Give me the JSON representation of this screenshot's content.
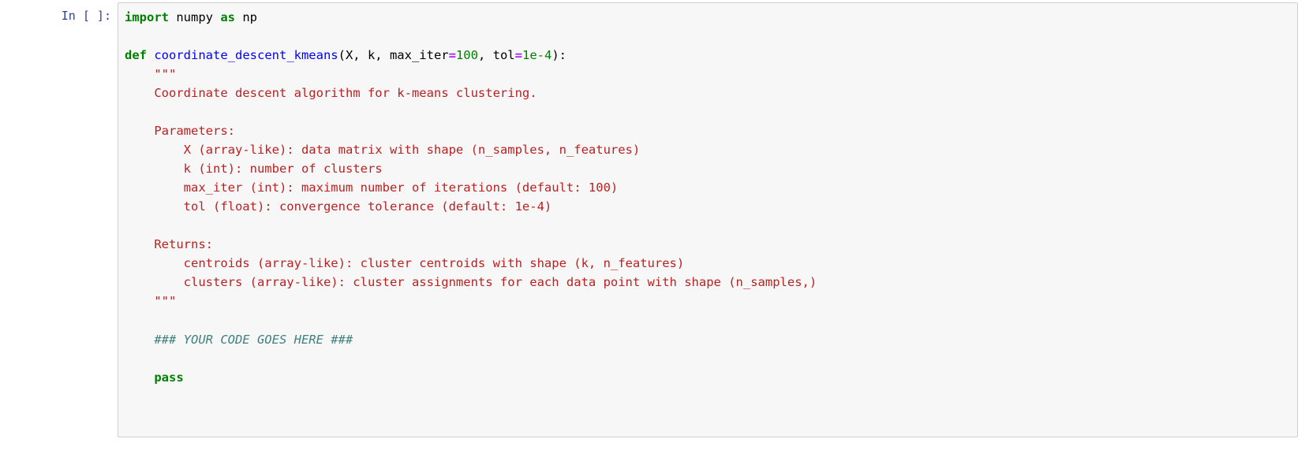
{
  "prompt": "In [ ]:",
  "code": {
    "l1": {
      "import": "import",
      "numpy": " numpy ",
      "as": "as",
      "np": " np"
    },
    "l2": "",
    "l3": {
      "def": "def",
      "sp": " ",
      "fn": "coordinate_descent_kmeans",
      "open": "(X, k, max_iter",
      "eq1": "=",
      "n100": "100",
      "c1": ", tol",
      "eq2": "=",
      "v1e4": "1e-4",
      "close": "):"
    },
    "l4": "    \"\"\"",
    "l5": "    Coordinate descent algorithm for k-means clustering.",
    "l6": "",
    "l7": "    Parameters:",
    "l8": "        X (array-like): data matrix with shape (n_samples, n_features)",
    "l9": "        k (int): number of clusters",
    "l10": "        max_iter (int): maximum number of iterations (default: 100)",
    "l11": "        tol (float): convergence tolerance (default: 1e-4)",
    "l12": "",
    "l13": "    Returns:",
    "l14": "        centroids (array-like): cluster centroids with shape (k, n_features)",
    "l15": "        clusters (array-like): cluster assignments for each data point with shape (n_samples,)",
    "l16": "    \"\"\"",
    "l17": "",
    "l18": {
      "indent": "    ",
      "text": "### YOUR CODE GOES HERE ###"
    },
    "l19": "",
    "l20": {
      "indent": "    ",
      "pass": "pass"
    }
  }
}
